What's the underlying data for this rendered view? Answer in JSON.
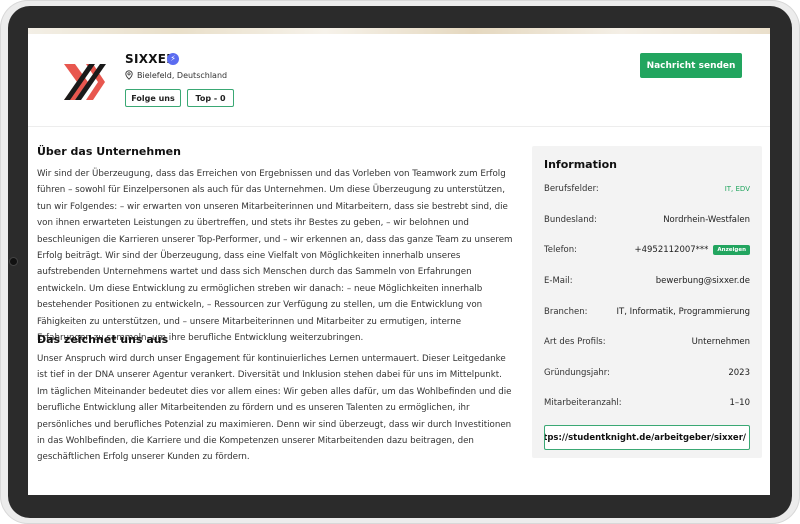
{
  "company": {
    "name": "SIXXER",
    "location": "Bielefeld, Deutschland",
    "follow_label": "Folge uns",
    "top_label": "Top - 0",
    "message_label": "Nachricht senden"
  },
  "about": {
    "title": "Über das Unternehmen",
    "body": "Wir sind der Überzeugung, dass das Erreichen von Ergebnissen und das Vorleben von Teamwork zum Erfolg führen – sowohl für Einzelpersonen als auch für das Unternehmen. Um diese Überzeugung zu unterstützen, tun wir Folgendes: – wir erwarten von unseren Mitarbeiterinnen und Mitarbeitern, dass sie bestrebt sind, die von ihnen erwarteten Leistungen zu übertreffen, und stets ihr Bestes zu geben, – wir belohnen und beschleunigen die Karrieren unserer Top-Performer, und – wir erkennen an, dass das ganze Team zu unserem Erfolg beiträgt. Wir sind der Überzeugung, dass eine Vielfalt von Möglichkeiten innerhalb unseres aufstrebenden Unternehmens wartet und dass sich Menschen durch das Sammeln von Erfahrungen entwickeln. Um diese Entwicklung zu ermöglichen streben wir danach: – neue Möglichkeiten innerhalb bestehender Positionen zu entwickeln, – Ressourcen zur Verfügung zu stellen, um die Entwicklung von Fähigkeiten zu unterstützen, und – unsere Mitarbeiterinnen und Mitarbeiter zu ermutigen, interne Erfahrungen zu sammeln, um ihre berufliche Entwicklung weiterzubringen."
  },
  "distinct": {
    "title": "Das zeichnet uns aus",
    "body": "Unser Anspruch wird durch unser Engagement für kontinuierliches Lernen untermauert. Dieser Leitgedanke ist tief in der DNA unserer Agentur verankert. Diversität und Inklusion stehen dabei für uns im Mittelpunkt. Im täglichen Miteinander bedeutet dies vor allem eines: Wir geben alles dafür, um das Wohlbefinden und die berufliche Entwicklung aller Mitarbeitenden zu fördern und es unseren Talenten zu ermöglichen, ihr persönliches und berufliches Potenzial zu maximieren. Denn wir sind überzeugt, dass wir durch Investitionen in das Wohlbefinden, die Karriere und die Kompetenzen unserer Mitarbeitenden dazu beitragen, den geschäftlichen Erfolg unserer Kunden zu fördern."
  },
  "info": {
    "title": "Information",
    "rows": [
      {
        "label": "Berufsfelder:",
        "value": "IT, EDV"
      },
      {
        "label": "Bundesland:",
        "value": "Nordrhein-Westfalen"
      },
      {
        "label": "Telefon:",
        "value": "+4952112007***",
        "action": "Anzeigen"
      },
      {
        "label": "E-Mail:",
        "value": "bewerbung@sixxer.de"
      },
      {
        "label": "Branchen:",
        "value": "IT, Informatik, Programmierung"
      },
      {
        "label": "Art des Profils:",
        "value": "Unternehmen"
      },
      {
        "label": "Gründungsjahr:",
        "value": "2023"
      },
      {
        "label": "Mitarbeiteranzahl:",
        "value": "1–10"
      }
    ],
    "url": "https://studentknight.de/arbeitgeber/sixxer/"
  },
  "colors": {
    "accent": "#22a55f",
    "verified": "#5b6cf0",
    "logo_red": "#e8574f",
    "logo_dark": "#1a1a1a"
  }
}
